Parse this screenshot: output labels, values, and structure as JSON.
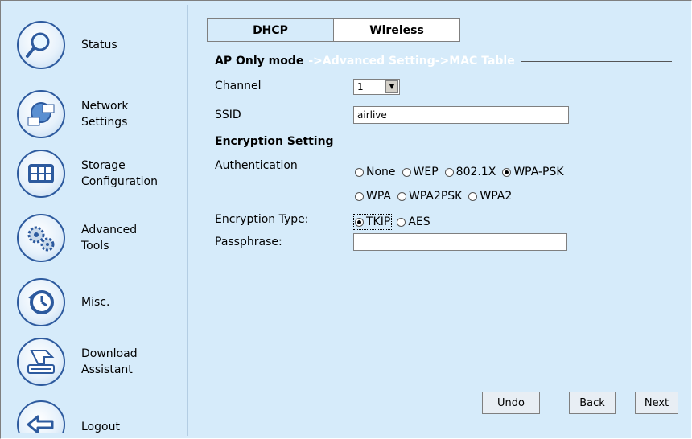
{
  "sidebar": {
    "items": [
      {
        "label": "Status",
        "icon": "magnifier-icon"
      },
      {
        "label": "Network\nSettings",
        "icon": "network-icon"
      },
      {
        "label": "Storage\nConfiguration",
        "icon": "storage-grid-icon"
      },
      {
        "label": "Advanced\nTools",
        "icon": "gears-icon"
      },
      {
        "label": "Misc.",
        "icon": "clock-icon"
      },
      {
        "label": "Download\nAssistant",
        "icon": "download-tray-icon"
      },
      {
        "label": "Logout",
        "icon": "back-arrow-icon"
      }
    ]
  },
  "tabs": [
    {
      "label": "DHCP"
    },
    {
      "label": "Wireless"
    }
  ],
  "header": {
    "mode": "AP Only mode",
    "breadcrumb": "->Advanced Setting->MAC Table"
  },
  "form": {
    "channel_label": "Channel",
    "channel_value": "1",
    "ssid_label": "SSID",
    "ssid_value": "airlive",
    "encryption_title": "Encryption Setting",
    "auth_label": "Authentication",
    "auth_options": [
      "None",
      "WEP",
      "802.1X",
      "WPA-PSK",
      "WPA",
      "WPA2PSK",
      "WPA2"
    ],
    "auth_selected": "WPA-PSK",
    "enc_type_label": "Encryption Type:",
    "enc_type_options": [
      "TKIP",
      "AES"
    ],
    "enc_type_selected": "TKIP",
    "passphrase_label": "Passphrase:",
    "passphrase_value": ""
  },
  "buttons": {
    "undo": "Undo",
    "back": "Back",
    "next": "Next"
  },
  "colors": {
    "background": "#d6ebfa",
    "icon_ring": "#2d5a9e"
  }
}
